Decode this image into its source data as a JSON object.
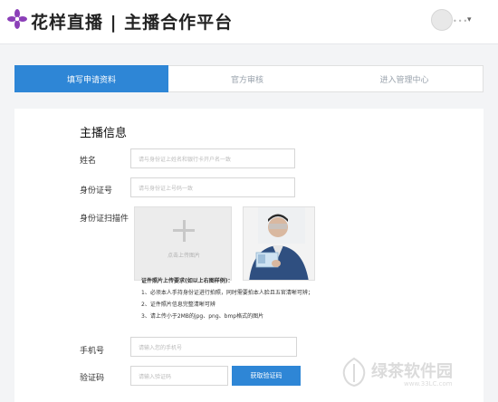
{
  "header": {
    "title": "花样直播 | 主播合作平台",
    "logo_icon": "flower-logo-icon",
    "avatar_icon": "avatar-icon"
  },
  "steps": [
    {
      "label": "填写申请资料",
      "active": true
    },
    {
      "label": "官方审核",
      "active": false
    },
    {
      "label": "进入管理中心",
      "active": false
    }
  ],
  "form": {
    "section_title": "主播信息",
    "name_label": "姓名",
    "name_placeholder": "请与身份证上姓名和银行卡开户名一致",
    "id_label": "身份证号",
    "id_placeholder": "请与身份证上号码一致",
    "scan_label": "身份证扫描件",
    "upload_text": "点击上传图片",
    "requirements": {
      "heading": "证件照片上传要求(如以上右图样例)：",
      "items": [
        "1、必须本人手持身份证进行拍照，同时需要拍本人脸且五官清晰可辨；",
        "2、证件照片信息完整清晰可辨",
        "3、请上传小于2MB的jpg、png、bmp格式的图片"
      ]
    },
    "phone_label": "手机号",
    "phone_placeholder": "请输入您的手机号",
    "code_label": "验证码",
    "code_placeholder": "请输入验证码",
    "get_code_button": "获取验证码"
  },
  "watermark": {
    "brand": "绿茶软件园",
    "url": "www.33LC.com"
  },
  "colors": {
    "accent": "#2e86d6",
    "logo_purple": "#8b3fb8"
  }
}
